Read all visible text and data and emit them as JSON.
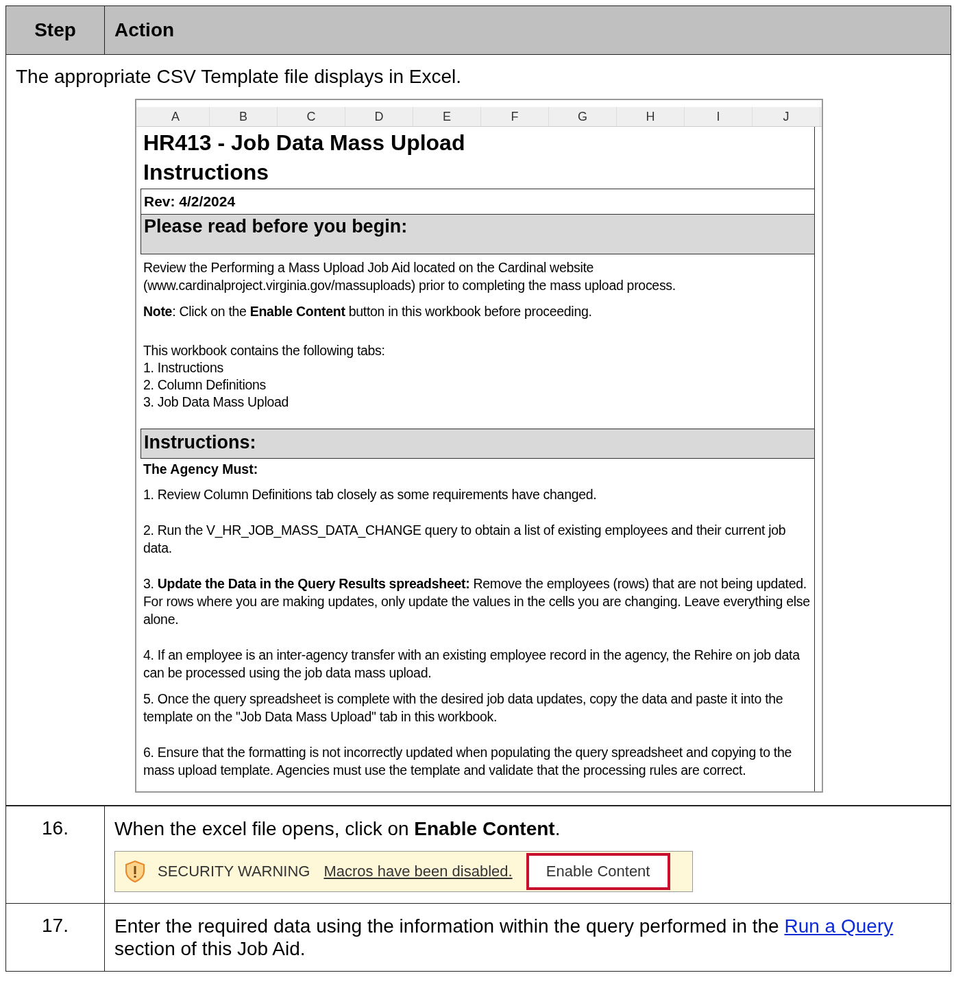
{
  "table": {
    "columns": [
      "Step",
      "Action"
    ],
    "intro": "The appropriate CSV Template file displays in Excel.",
    "excel": {
      "column_headers": [
        "A",
        "B",
        "C",
        "D",
        "E",
        "F",
        "G",
        "H",
        "I",
        "J"
      ],
      "blocks": [
        {
          "kind": "title",
          "text": "HR413 - Job Data Mass Upload Instructions"
        },
        {
          "kind": "rev",
          "text": "Rev: 4/2/2024"
        },
        {
          "kind": "heading",
          "text": "Please read before you begin:"
        },
        {
          "kind": "para",
          "text": "Review the Performing a Mass Upload Job Aid located on the Cardinal website (www.cardinalproject.virginia.gov/massuploads) prior to completing the mass upload process."
        },
        {
          "kind": "para",
          "text": "**Note**: Click on the **Enable Content** button in this workbook before proceeding."
        },
        {
          "kind": "gap-line",
          "text": "This workbook contains the following tabs:"
        },
        {
          "kind": "line",
          "text": "1. Instructions"
        },
        {
          "kind": "line",
          "text": "2. Column Definitions"
        },
        {
          "kind": "line",
          "text": "3. Job Data Mass Upload"
        },
        {
          "kind": "heading-small",
          "text": "Instructions:"
        },
        {
          "kind": "subhead",
          "text": "The Agency Must:"
        },
        {
          "kind": "para",
          "text": "1. Review Column Definitions tab closely as some requirements have changed."
        },
        {
          "kind": "para",
          "text": "2. Run the V_HR_JOB_MASS_DATA_CHANGE query to obtain a list of existing employees and their current job data."
        },
        {
          "kind": "para-wide",
          "text": "3. **Update the Data in the Query Results spreadsheet:**  Remove the employees (rows) that are not being updated.  For rows where you are making updates, only update the values in the cells you are changing.  Leave everything else alone."
        },
        {
          "kind": "para-wide",
          "text": "4.  If an employee is an inter-agency transfer with an existing employee record in the agency, the Rehire on job data can be processed using the job data mass upload."
        },
        {
          "kind": "para",
          "text": "5. Once the query spreadsheet is complete with the desired job data updates, copy the data and paste it into the template on the \"Job Data Mass Upload\" tab in this workbook."
        },
        {
          "kind": "para",
          "text": "6. Ensure that the formatting is not incorrectly updated when populating the query spreadsheet and copying to the mass upload template.  Agencies must use the template and validate that the processing rules are correct."
        }
      ]
    },
    "steps": [
      {
        "number": "16.",
        "text": "When the excel file opens, click on **Enable Content**.",
        "security_bar": {
          "label": "SECURITY WARNING",
          "message": "Macros have been disabled.",
          "button": {
            "label": "Enable Content",
            "highlighted": true
          }
        }
      },
      {
        "number": "17.",
        "text": "Enter the required data using the information within the query performed in the",
        "link": "Run a Query",
        "text_after": "section of this Job Aid."
      }
    ]
  }
}
